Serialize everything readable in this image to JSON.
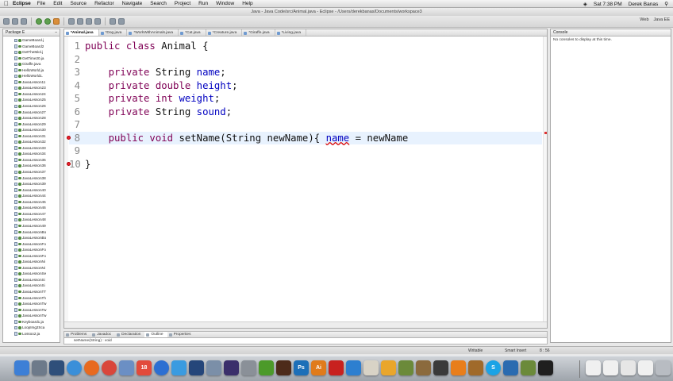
{
  "menubar": {
    "app": "Eclipse",
    "items": [
      "File",
      "Edit",
      "Source",
      "Refactor",
      "Navigate",
      "Search",
      "Project",
      "Run",
      "Window",
      "Help"
    ],
    "clock": "Sat 7:38 PM",
    "user": "Derek Banas"
  },
  "window": {
    "title": "Java - Java Code/src/Animal.java - Eclipse - /Users/derekbanas/Documents/workspace3"
  },
  "toolbar": {
    "perspectives": [
      "Web",
      "Java EE"
    ]
  },
  "package_explorer": {
    "title": "Package E",
    "items": [
      "GameBoard.j",
      "GameBoard2",
      "GetTheMiol.j",
      "GetTime20.ja",
      "Giraffe.java",
      "HelloWorld.ja",
      "HelloWorld1.",
      "JavaLesson11",
      "JavaLesson23",
      "JavaLesson24",
      "JavaLesson25",
      "JavaLesson26",
      "JavaLesson27",
      "JavaLesson28",
      "JavaLesson29",
      "JavaLesson30",
      "JavaLesson31",
      "JavaLesson32",
      "JavaLesson33",
      "JavaLesson34",
      "JavaLesson35",
      "JavaLesson36",
      "JavaLesson37",
      "JavaLesson38",
      "JavaLesson39",
      "JavaLesson40",
      "JavaLesson44",
      "JavaLesson45",
      "JavaLesson46",
      "JavaLesson47",
      "JavaLesson48",
      "JavaLesson49",
      "JavaLessonBo",
      "JavaLessonBo",
      "JavaLessonFo",
      "JavaLessonFo",
      "JavaLessonFo",
      "JavaLessonNi",
      "JavaLessonNi",
      "JavaLessonSe",
      "JavaLessonSi",
      "JavaLessonSi",
      "JavaLessonTT",
      "JavaLessonTh",
      "JavaLessonTw",
      "JavaLessonTw",
      "JavaLessonTw",
      "Keyboard1.ja",
      "LoopImg2Sca",
      "Lossoo2.ja"
    ]
  },
  "editor": {
    "tabs": [
      "*Animal.java",
      "*Dog.java",
      "*WorkWithAnimals.java",
      "*Cat.java",
      "*Creature.java",
      "*Giraffe.java",
      "*Living.java"
    ],
    "active_tab": 0,
    "lines": [
      {
        "n": "1",
        "kw": "public class",
        "rest": " Animal {",
        "field": "",
        "after": ""
      },
      {
        "n": "2",
        "kw": "",
        "rest": "",
        "field": "",
        "after": ""
      },
      {
        "n": "3",
        "kw": "    private",
        "rest": " String ",
        "field": "name",
        "after": ";"
      },
      {
        "n": "4",
        "kw": "    private double",
        "rest": " ",
        "field": "height",
        "after": ";"
      },
      {
        "n": "5",
        "kw": "    private int",
        "rest": " ",
        "field": "weight",
        "after": ";"
      },
      {
        "n": "6",
        "kw": "    private",
        "rest": " String ",
        "field": "sound",
        "after": ";"
      },
      {
        "n": "7",
        "kw": "",
        "rest": "",
        "field": "",
        "after": ""
      },
      {
        "n": "8",
        "kw": "    public void",
        "rest": " setName(String newName){ ",
        "field": "name",
        "after": " = newName"
      },
      {
        "n": "9",
        "kw": "",
        "rest": "",
        "field": "",
        "after": ""
      },
      {
        "n": "10",
        "kw": "",
        "rest": "}",
        "field": "",
        "after": ""
      }
    ]
  },
  "console": {
    "title": "Console",
    "message": "No consoles to display at this time."
  },
  "bottom_tabs": [
    "Problems",
    "Javadoc",
    "Declaration",
    "Outline",
    "Properties"
  ],
  "outline": {
    "item": "setName(String) : void"
  },
  "status": {
    "writable": "Writable",
    "insert": "Smart Insert",
    "position": "8 : 56"
  },
  "dock": {
    "icons": [
      {
        "name": "finder-icon",
        "label": "",
        "color": "#3d7fd6"
      },
      {
        "name": "launchpad-icon",
        "label": "",
        "color": "#6d7a8a"
      },
      {
        "name": "mission-control-icon",
        "label": "",
        "color": "#2f4f7a"
      },
      {
        "name": "safari-icon",
        "label": "",
        "color": "#3a8fd9"
      },
      {
        "name": "firefox-icon",
        "label": "",
        "color": "#e86a1f"
      },
      {
        "name": "chrome-icon",
        "label": "",
        "color": "#d9463b"
      },
      {
        "name": "mail-icon",
        "label": "",
        "color": "#6b8fc4"
      },
      {
        "name": "calendar-icon",
        "label": "18",
        "color": "#e24a3b"
      },
      {
        "name": "itunes-icon",
        "label": "",
        "color": "#2c6fd2"
      },
      {
        "name": "app-store-icon",
        "label": "",
        "color": "#3a9be0"
      },
      {
        "name": "quicktime-icon",
        "label": "",
        "color": "#25467a"
      },
      {
        "name": "preview-icon",
        "label": "",
        "color": "#7b8fa8"
      },
      {
        "name": "eclipse-icon",
        "label": "",
        "color": "#3b2f6b"
      },
      {
        "name": "screenshot-icon",
        "label": "",
        "color": "#8a9098"
      },
      {
        "name": "dreamweaver-icon",
        "label": "",
        "color": "#4c9a2a"
      },
      {
        "name": "flash-icon",
        "label": "",
        "color": "#4d2b1a"
      },
      {
        "name": "photoshop-icon",
        "label": "Ps",
        "color": "#1d6fb8"
      },
      {
        "name": "illustrator-icon",
        "label": "Ai",
        "color": "#e07b1b"
      },
      {
        "name": "acrobat-icon",
        "label": "",
        "color": "#c8211f"
      },
      {
        "name": "network-icon",
        "label": "",
        "color": "#2d7fd0"
      },
      {
        "name": "textedit-icon",
        "label": "",
        "color": "#d8d3c6"
      },
      {
        "name": "photos-icon",
        "label": "",
        "color": "#e9a62c"
      },
      {
        "name": "minecraft-icon",
        "label": "",
        "color": "#6b8a3a"
      },
      {
        "name": "box-icon",
        "label": "",
        "color": "#8b6a3d"
      },
      {
        "name": "clapper-icon",
        "label": "",
        "color": "#3a3a3a"
      },
      {
        "name": "vlc-icon",
        "label": "",
        "color": "#e87e1b"
      },
      {
        "name": "utility-icon",
        "label": "",
        "color": "#a06a2a"
      },
      {
        "name": "skype-icon",
        "label": "S",
        "color": "#1ba3e6"
      },
      {
        "name": "screen-recorder-icon",
        "label": "",
        "color": "#2a6bb0"
      },
      {
        "name": "compressor-icon",
        "label": "",
        "color": "#6b8a3a"
      },
      {
        "name": "terminal-icon",
        "label": "",
        "color": "#1f1f1f"
      }
    ],
    "right_icons": [
      {
        "name": "document-icon",
        "color": "#f0f0f0"
      },
      {
        "name": "document-icon",
        "color": "#f0f0f0"
      },
      {
        "name": "downloads-icon",
        "color": "#e6e6e6"
      },
      {
        "name": "document-icon",
        "color": "#f0f0f0"
      },
      {
        "name": "trash-icon",
        "color": "#b8bcc2"
      }
    ]
  }
}
